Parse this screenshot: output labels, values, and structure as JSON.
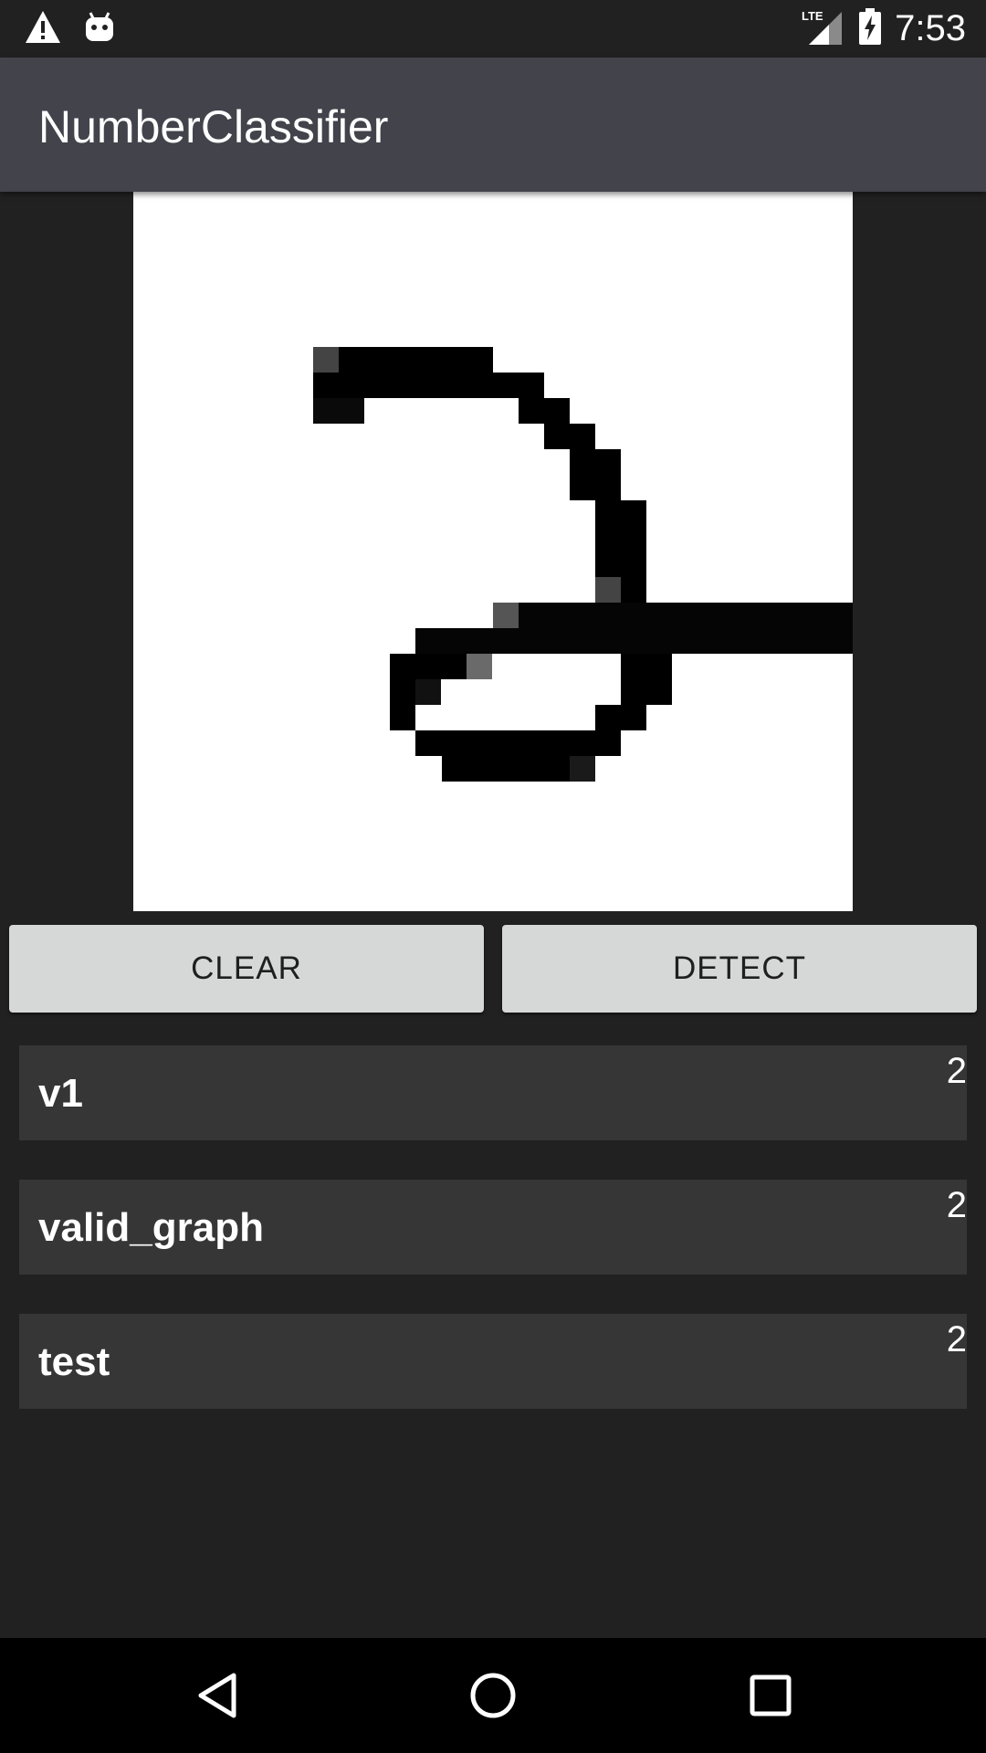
{
  "status_bar": {
    "time": "7:53",
    "network_label": "LTE",
    "icons": [
      "warning-icon",
      "android-icon",
      "signal-lte-icon",
      "battery-charging-icon"
    ]
  },
  "app_bar": {
    "title": "NumberClassifier"
  },
  "buttons": {
    "clear_label": "CLEAR",
    "detect_label": "DETECT"
  },
  "results": [
    {
      "name": "v1",
      "value": "2"
    },
    {
      "name": "valid_graph",
      "value": "2"
    },
    {
      "name": "test",
      "value": "2"
    }
  ],
  "nav_bar": {
    "icons": [
      "back-icon",
      "home-icon",
      "recent-apps-icon"
    ]
  },
  "colors": {
    "background": "#212121",
    "app_bar": "#42434b",
    "button": "#d6d7d7",
    "result_card": "#363636",
    "drawing_canvas": "#ffffff",
    "ink": "#000000"
  }
}
